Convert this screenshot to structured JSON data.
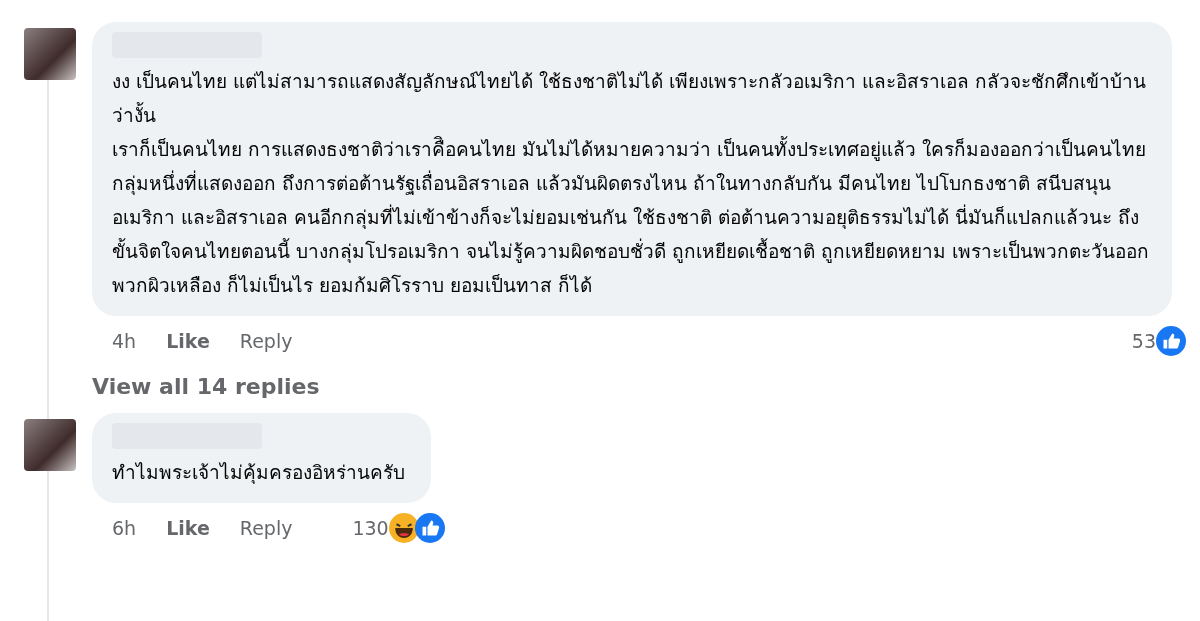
{
  "comments": [
    {
      "paragraphs": [
        "งง เป็นคนไทย แต่ไม่สามารถแสดงสัญลักษณ์ไทยได้ ใช้ธงชาติไม่ได้ เพียงเพราะกลัวอเมริกา และอิสราเอล กลัวจะชักศึกเข้าบ้าน ว่างั้น",
        "เราก็เป็นคนไทย การแสดงธงชาติว่าเราคืิอคนไทย มันไม่ได้หมายความว่า เป็นคนทั้งประเทศอยู่แล้ว ใครก็มองออกว่าเป็นคนไทยกลุ่มหนึ่งที่แสดงออก ถึงการต่อต้านรัฐเถื่อนอิสราเอล แล้วมันผิดตรงไหน ถ้าในทางกลับกัน มีคนไทย ไปโบกธงชาติ สนีบสนุน อเมริกา และอิสราเอล คนอีกกลุ่มที่ไม่เข้าข้างก็จะไม่ยอมเช่นกัน ใช้ธงชาติ ต่อต้านความอยุติธรรมไม่ได้ นี่มันก็แปลกแล้วนะ ถึงขั้นจิตใจคนไทยตอนนี้ บางกลุ่มโปรอเมริกา จนไม่รู้ความผิดชอบชั่วดี ถูกเหยียดเชื้อชาติ ถูกเหยียดหยาม เพราะเป็นพวกตะวันออก พวกผิวเหลือง ก็ไม่เป็นไร ยอมก้มศิโรราบ ยอมเป็นทาส ก็ได้"
      ],
      "time": "4h",
      "like": "Like",
      "reply": "Reply",
      "count": "53",
      "reactions": [
        {
          "kind": "like"
        }
      ]
    },
    {
      "paragraphs": [
        "ทำไมพระเจ้าไม่คุ้มครองอิหร่านครับ"
      ],
      "time": "6h",
      "like": "Like",
      "reply": "Reply",
      "count": "130",
      "reactions": [
        {
          "kind": "haha"
        },
        {
          "kind": "like"
        }
      ]
    }
  ],
  "view_replies": "View all 14 replies"
}
